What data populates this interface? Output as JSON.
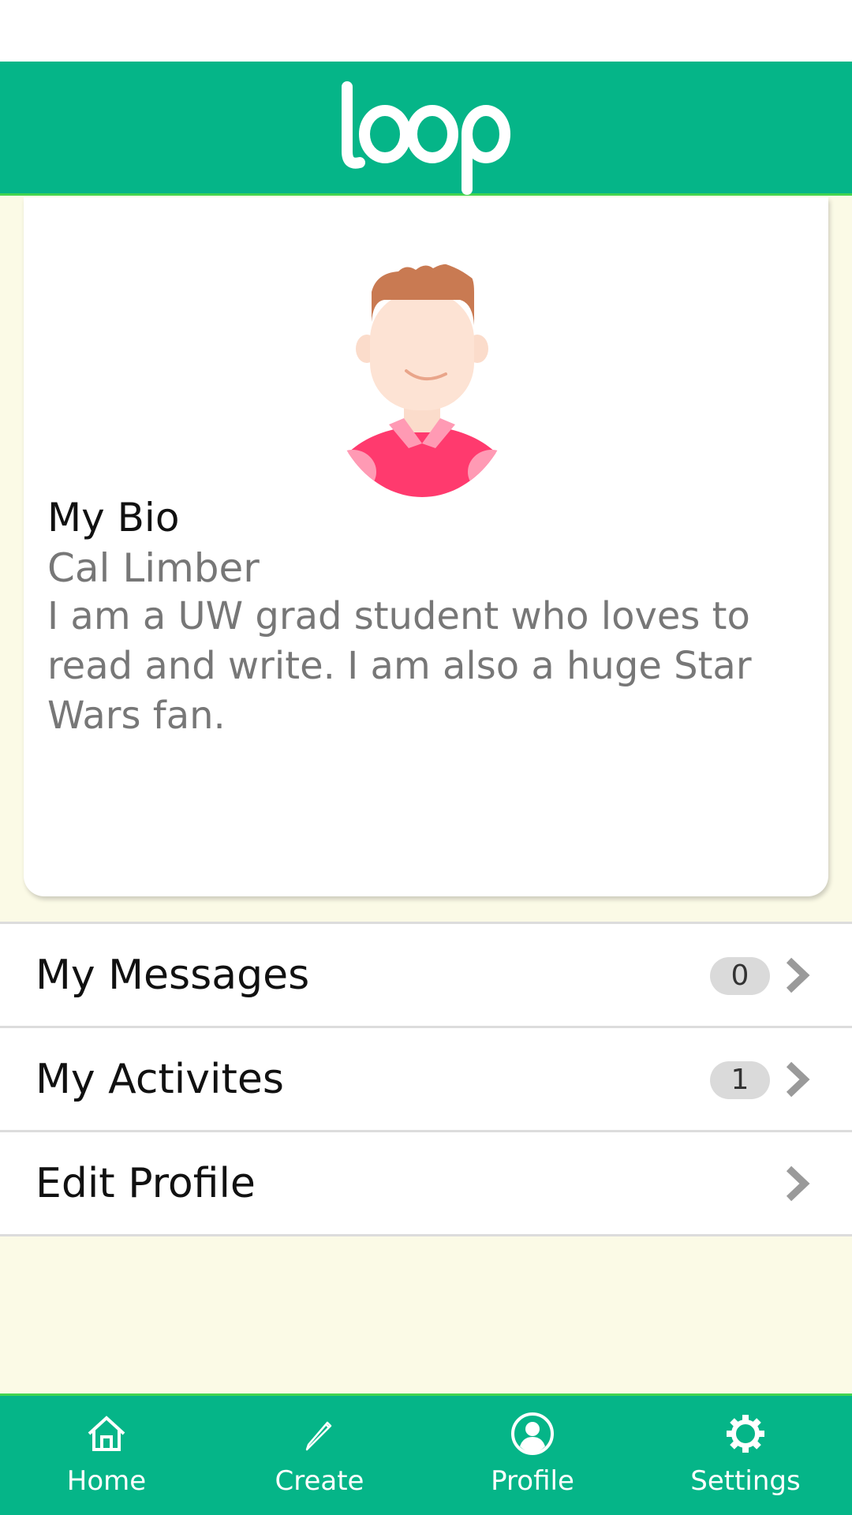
{
  "app": {
    "logo_text": "loop",
    "brand_color": "#05b588",
    "accent_line_color": "#43d44f",
    "background_color": "#fbfae6"
  },
  "profile": {
    "avatar_icon": "user-avatar-icon",
    "bio_heading": "My Bio",
    "name": "Cal Limber",
    "bio": "I am a UW grad student who loves to read and write. I am also a huge Star Wars fan."
  },
  "menu": {
    "items": [
      {
        "label": "My Messages",
        "badge": "0",
        "icon": "chevron-right-icon"
      },
      {
        "label": "My Activites",
        "badge": "1",
        "icon": "chevron-right-icon"
      },
      {
        "label": "Edit Profile",
        "icon": "chevron-right-icon"
      }
    ]
  },
  "bottom_nav": {
    "items": [
      {
        "label": "Home",
        "icon": "home-icon"
      },
      {
        "label": "Create",
        "icon": "pencil-icon"
      },
      {
        "label": "Profile",
        "icon": "profile-icon"
      },
      {
        "label": "Settings",
        "icon": "gear-icon"
      }
    ]
  }
}
